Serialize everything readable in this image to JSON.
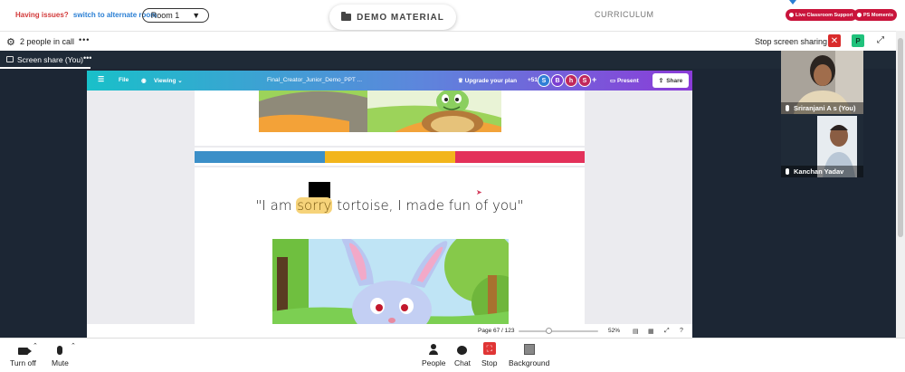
{
  "topbar": {
    "issues_text": "Having issues?",
    "alternate_room_link": "switch to alternate room",
    "room_value": "Room 1",
    "demo_material_label": "DEMO MATERIAL",
    "curriculum_label": "CURRICULUM",
    "live_support_label": "Live Classroom Support",
    "ps_moments_label": "PS Moments"
  },
  "callbar": {
    "people_count": "2 people in call",
    "more_label": "•••",
    "stop_sharing_label": "Stop screen sharing",
    "close_label": "✕",
    "participant_initial": "P"
  },
  "share_tab": {
    "label": "Screen share (You)",
    "more_label": "•••"
  },
  "canva": {
    "menu_icon": "☰",
    "file_label": "File",
    "viewing_label": "Viewing",
    "doc_title": "Final_Creator_Junior_Demo_PPT ...",
    "upgrade_label": "Upgrade your plan",
    "extra_count": "+51",
    "avatars": [
      {
        "letter": "S",
        "color": "#2f7fd6"
      },
      {
        "letter": "B",
        "color": "#7b3fd1"
      },
      {
        "letter": "h",
        "color": "#c1285b"
      },
      {
        "letter": "S",
        "color": "#c1285b"
      }
    ],
    "present_label": "Present",
    "share_label": "Share",
    "slide_quote_pre": "\"I am ",
    "slide_quote_highlight": "sorry",
    "slide_quote_post": " tortoise, I made fun of you\"",
    "page_indicator": "Page 67 / 123",
    "zoom_value": "52%",
    "zoom_fraction": 0.38,
    "stripe_colors": [
      "#3b8fc8",
      "#f2b51c",
      "#e3315a"
    ]
  },
  "participants": [
    {
      "name": "Sriranjani A s (You)"
    },
    {
      "name": "Kanchan Yadav"
    }
  ],
  "bottombar": {
    "turn_off_label": "Turn off",
    "mute_label": "Mute",
    "people_label": "People",
    "chat_label": "Chat",
    "stop_label": "Stop",
    "background_label": "Background"
  }
}
